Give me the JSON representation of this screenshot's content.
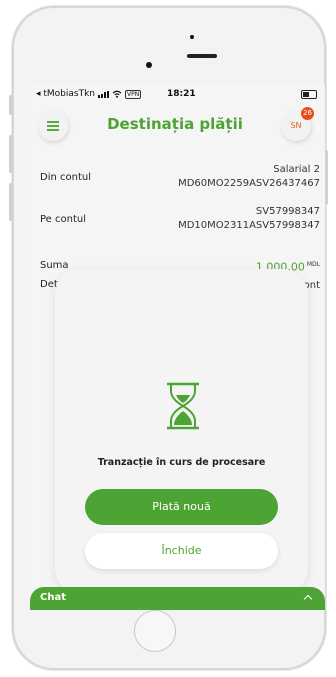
{
  "status_bar": {
    "carrier": "◂ tMobiasTkn",
    "vpn": "VPN",
    "time": "18:21"
  },
  "header": {
    "title": "Destinația plății",
    "avatar_initials": "SN",
    "notification_count": "26"
  },
  "fields": [
    {
      "label": "Din contul",
      "value_line1": "Salarial 2",
      "value_line2": "MD60MO2259ASV26437467"
    },
    {
      "label": "Pe contul",
      "value_line1": "SV57998347",
      "value_line2": "MD10MO2311ASV57998347"
    },
    {
      "label": "Suma",
      "amount": "1 000.00",
      "currency": "MDL"
    },
    {
      "label": "Detalii",
      "value_line1": "suplinire cont"
    }
  ],
  "card": {
    "icon": "hourglass-icon",
    "status_text": "Tranzacție în curs de procesare",
    "primary_button": "Plată nouă",
    "secondary_button": "Închide"
  },
  "chat": {
    "label": "Chat"
  },
  "colors": {
    "accent": "#4da334",
    "badge": "#e84d1b"
  }
}
